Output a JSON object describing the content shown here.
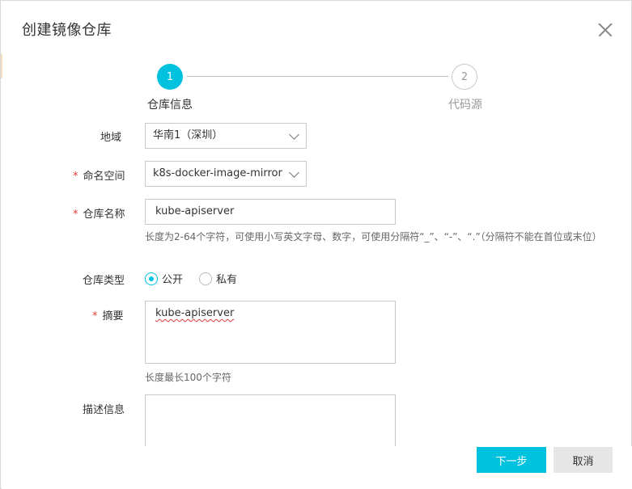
{
  "dialog": {
    "title": "创建镜像仓库"
  },
  "steps": [
    {
      "number": "1",
      "label": "仓库信息"
    },
    {
      "number": "2",
      "label": "代码源"
    }
  ],
  "form": {
    "region": {
      "label": "地域",
      "value": "华南1（深圳）"
    },
    "namespace": {
      "required_mark": "*",
      "label": "命名空间",
      "value": "k8s-docker-image-mirror"
    },
    "repo_name": {
      "required_mark": "*",
      "label": "仓库名称",
      "value": "kube-apiserver",
      "hint": "长度为2-64个字符，可使用小写英文字母、数字，可使用分隔符“_”、“-”、“.”（分隔符不能在首位或末位）"
    },
    "repo_type": {
      "label": "仓库类型",
      "options": [
        "公开",
        "私有"
      ],
      "selected": "公开"
    },
    "summary": {
      "required_mark": "*",
      "label": "摘要",
      "value": "kube-apiserver",
      "hint": "长度最长100个字符"
    },
    "description": {
      "label": "描述信息",
      "value": ""
    }
  },
  "buttons": {
    "next": "下一步",
    "cancel": "取消"
  },
  "colors": {
    "accent": "#00c1de",
    "required": "#e23c39"
  }
}
